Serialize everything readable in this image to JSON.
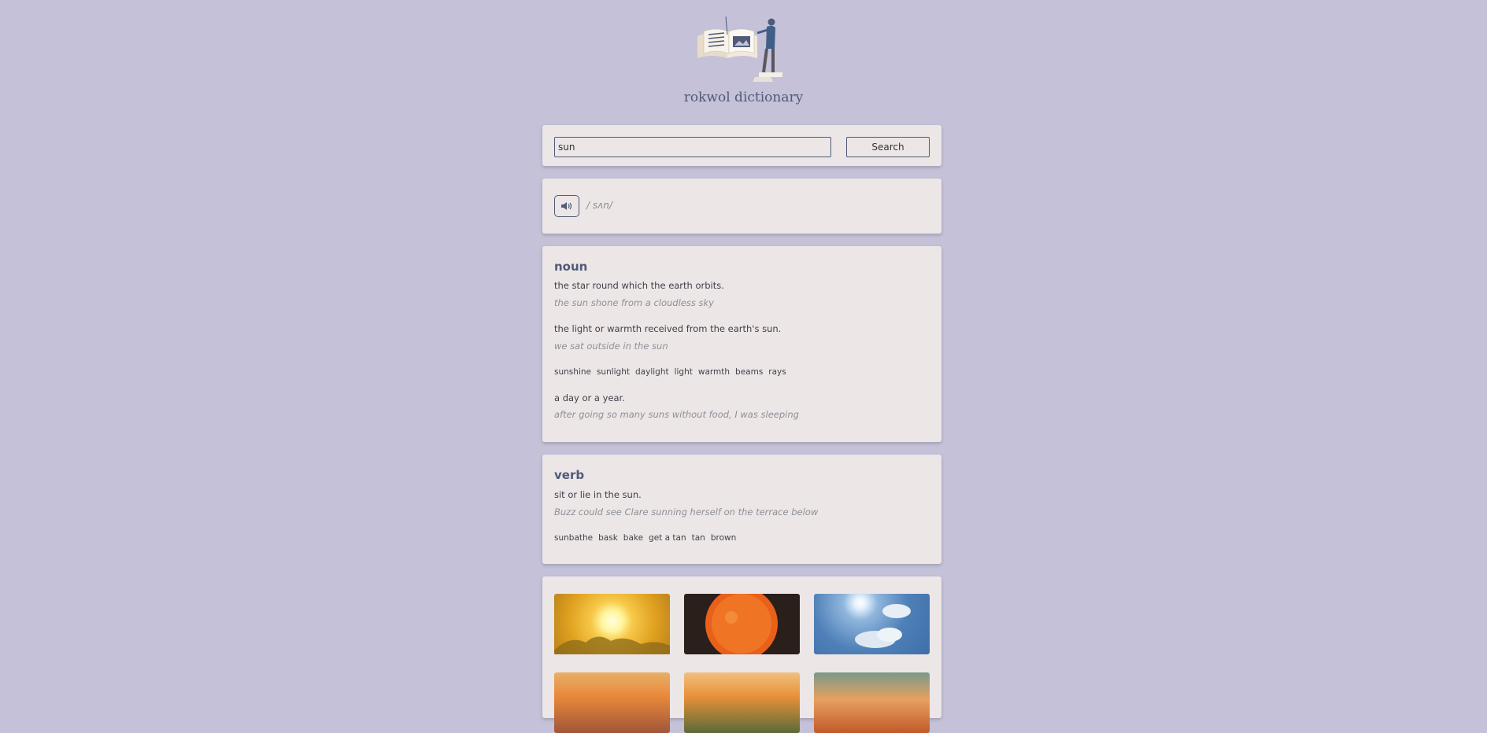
{
  "app": {
    "title": "rokwol dictionary"
  },
  "search": {
    "value": "sun",
    "button_label": "Search"
  },
  "pronunciation": {
    "phonetic": "/ sʌn/"
  },
  "meanings": [
    {
      "part_of_speech": "noun",
      "definitions": [
        {
          "definition": "the star round which the earth orbits.",
          "example": "the sun shone from a cloudless sky"
        },
        {
          "definition": "the light or warmth received from the earth's sun.",
          "example": "we sat outside in the sun",
          "synonyms": [
            "sunshine",
            "sunlight",
            "daylight",
            "light",
            "warmth",
            "beams",
            "rays"
          ]
        },
        {
          "definition": "a day or a year.",
          "example": "after going so many suns without food, I was sleeping"
        }
      ]
    },
    {
      "part_of_speech": "verb",
      "definitions": [
        {
          "definition": "sit or lie in the sun.",
          "example": "Buzz could see Clare sunning herself on the terrace below",
          "synonyms": [
            "sunbathe",
            "bask",
            "bake",
            "get a tan",
            "tan",
            "brown"
          ]
        }
      ]
    }
  ],
  "colors": {
    "background": "#c4c1d8",
    "card": "#ece6e6",
    "accent": "#4f5a78"
  },
  "icons": {
    "logo": "book-reader-illustration",
    "audio": "speaker-icon"
  }
}
